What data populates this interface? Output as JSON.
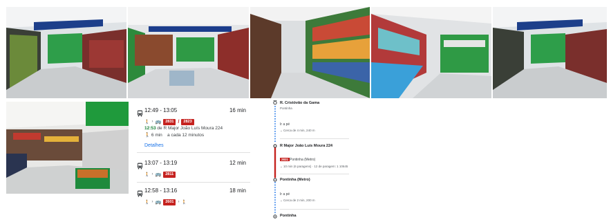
{
  "routes": [
    {
      "time": "12:49 - 13:05",
      "duration": "16 min",
      "lines": [
        "2831",
        "2823"
      ],
      "departure_time": "12:53",
      "departure_text": " de R Major João Luís Moura 224",
      "walk": "6 min",
      "frequency": "a cada 12 minutos",
      "details_label": "Detalhes"
    },
    {
      "time": "13:07 - 13:19",
      "duration": "12 min",
      "lines": [
        "2811"
      ]
    },
    {
      "time": "12:58 - 13:16",
      "duration": "18 min",
      "lines": [
        "2601"
      ]
    }
  ],
  "timeline": {
    "origin": "R. Cristóvão da Gama",
    "origin_sub": "Pontinha",
    "walk1": "Ir a pé",
    "walk1_detail": "Cerca de 4 min, 240 m",
    "stop1": "R Major João Luís Moura 224",
    "bus_line": "2831",
    "bus_dest": "Pontinha (Metro)",
    "bus_detail": "10 min (6 paragens) · 12 de paragem: 1 10645",
    "stop2": "Pontinha (Metro)",
    "walk2": "Ir a pé",
    "walk2_detail": "Cerca de 2 min, 200 m",
    "destination": "Pontinha"
  },
  "colors": {
    "bus_red": "#c5221f",
    "link_blue": "#1a73e8",
    "walk_green": "#188038",
    "walk_dots": "#1a73e8"
  }
}
